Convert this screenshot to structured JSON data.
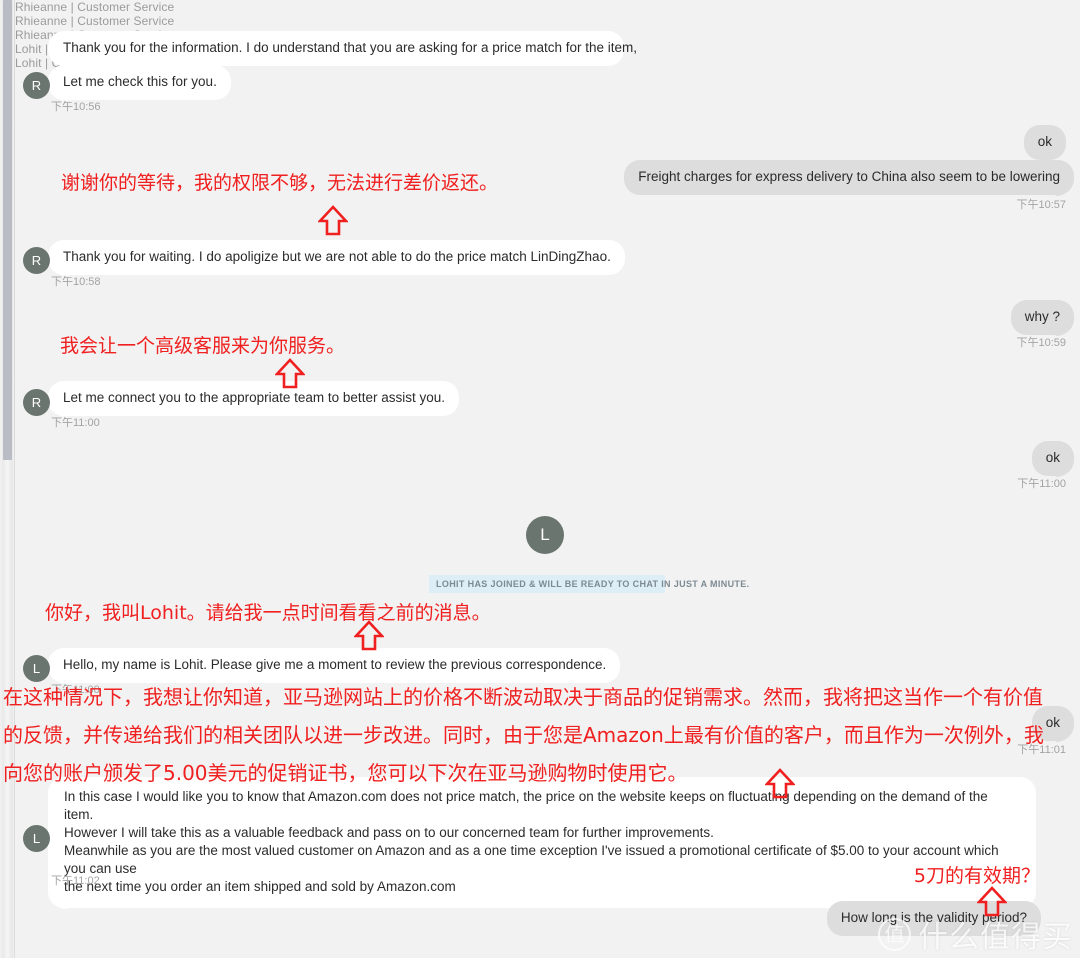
{
  "app": {
    "watermark_logo": "值",
    "watermark_text": "什么值得买"
  },
  "system": {
    "join_notice": "LOHIT HAS JOINED & WILL BE READY TO CHAT IN JUST A MINUTE."
  },
  "agents": {
    "rhieanne_label": "Rhieanne | Customer Service",
    "rhieanne_initial": "R",
    "lohit_label": "Lohit | Customer Service",
    "lohit_initial": "L"
  },
  "messages": [
    {
      "id": "m1",
      "side": "in",
      "sender": "Rhieanne | Customer Service",
      "text": "Thank you for the information. I do understand that you are asking for a price match for the item,",
      "time": ""
    },
    {
      "id": "m2",
      "side": "in",
      "sender": "",
      "text": "Let me check this for you.",
      "time": "下午10:56"
    },
    {
      "id": "m3",
      "side": "out",
      "text": "ok",
      "time": ""
    },
    {
      "id": "m4",
      "side": "out",
      "text": "Freight charges for express delivery to China also seem to be lowering",
      "time": "下午10:57"
    },
    {
      "id": "m5",
      "side": "in",
      "sender": "Rhieanne | Customer Service",
      "text": "Thank you for waiting. I do apoligize but we are not able to do the price match LinDingZhao.",
      "time": "下午10:58"
    },
    {
      "id": "m6",
      "side": "out",
      "text": "why ?",
      "time": "下午10:59"
    },
    {
      "id": "m7",
      "side": "in",
      "sender": "Rhieanne | Customer Service",
      "text": "Let me connect you to the appropriate team to better assist you.",
      "time": "下午11:00"
    },
    {
      "id": "m8",
      "side": "out",
      "text": "ok",
      "time": "下午11:00"
    },
    {
      "id": "m9",
      "side": "in",
      "sender": "Lohit | Customer Service",
      "text": "Hello, my name is Lohit. Please give me a moment to review the previous correspondence.",
      "time": "下午11:00"
    },
    {
      "id": "m10",
      "side": "out",
      "text": "ok",
      "time": "下午11:01"
    },
    {
      "id": "m11",
      "side": "in",
      "sender": "Lohit | Customer Service",
      "lines": [
        "In this case I would like you to know that Amazon.com does not price match, the price on the website keeps on fluctuating depending on the demand of the item.",
        "However I will take this as a valuable feedback and pass on to our concerned team for further improvements.",
        "Meanwhile as you are the most valued customer on Amazon and as a one time exception I've issued a promotional certificate of $5.00 to your account which you can use",
        "the next time you order an item shipped and sold by Amazon.com"
      ],
      "time": "下午11:02"
    },
    {
      "id": "m12",
      "side": "out",
      "text": "How long is the validity period?",
      "time": ""
    }
  ],
  "annotations": [
    {
      "id": "a1",
      "text": "谢谢你的等待，我的权限不够，无法进行差价返还。"
    },
    {
      "id": "a2",
      "text": "我会让一个高级客服来为你服务。"
    },
    {
      "id": "a3",
      "text": "你好，我叫Lohit。请给我一点时间看看之前的消息。"
    },
    {
      "id": "a4",
      "text": "在这种情况下，我想让你知道，亚马逊网站上的价格不断波动取决于商品的促销需求。然而，我将把这当作一个有价值的反馈，并传递给我们的相关团队以进一步改进。同时，由于您是Amazon上最有价值的客户，而且作为一次例外，我向您的账户颁发了5.00美元的促销证书，您可以下次在亚马逊购物时使用它。"
    },
    {
      "id": "a5",
      "text": "5刀的有效期？"
    }
  ],
  "colors": {
    "background": "#f2f2f2",
    "incoming_bubble": "#ffffff",
    "outgoing_bubble": "#dddddd",
    "annotation_red": "#f02020",
    "avatar": "#6b756f",
    "system_banner": "#ddeef7"
  }
}
